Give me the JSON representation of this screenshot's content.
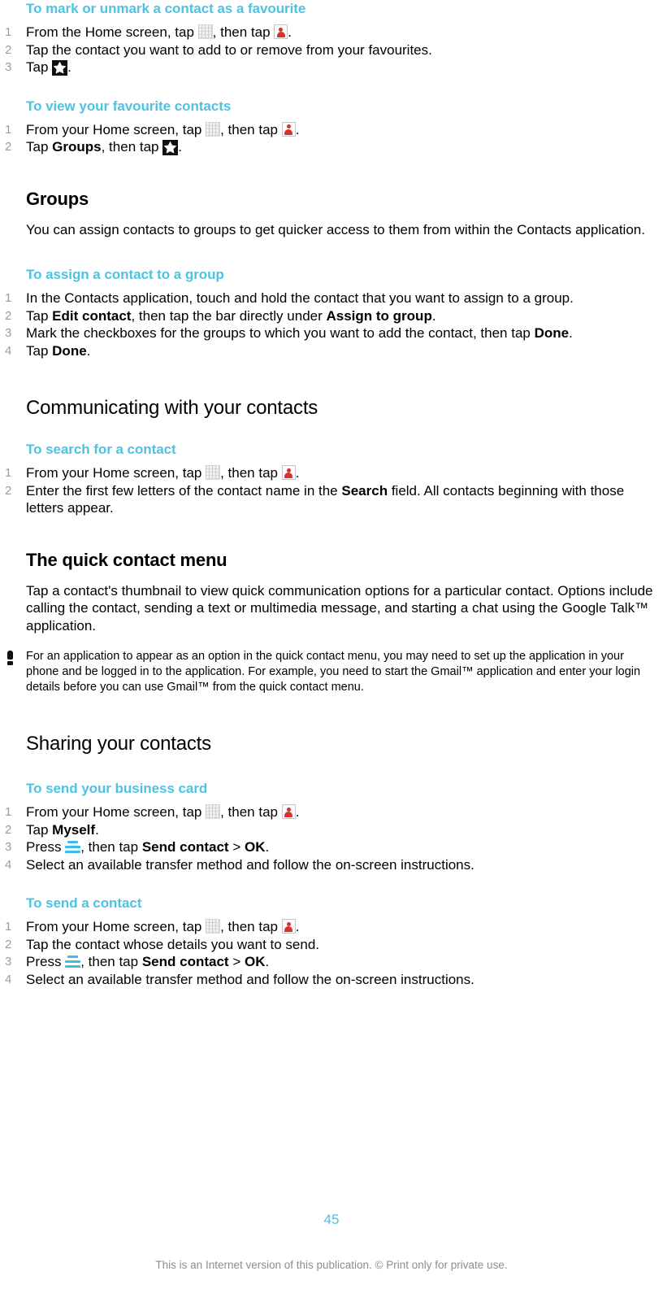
{
  "colors": {
    "heading_accent": "#4FC2E3",
    "step_number": "#9c9c9c",
    "body_text": "#000000",
    "footer_text": "#8d8d8d",
    "menu_key": "#3FBCE0",
    "contacts_icon_red": "#d8322c"
  },
  "sections": {
    "favourite": {
      "heading": "To mark or unmark a contact as a favourite",
      "step1_a": "From the Home screen, tap",
      "step1_b": ", then tap",
      "step1_c": ".",
      "step2": "Tap the contact you want to add to or remove from your favourites.",
      "step3_a": "Tap",
      "step3_b": "."
    },
    "view_favourites": {
      "heading": "To view your favourite contacts",
      "step1_a": "From your Home screen, tap",
      "step1_b": ", then tap",
      "step1_c": ".",
      "step2_a": "Tap",
      "step2_bold": "Groups",
      "step2_b": ", then tap",
      "step2_c": "."
    },
    "groups": {
      "heading": "Groups",
      "intro": "You can assign contacts to groups to get quicker access to them from within the Contacts application."
    },
    "assign_group": {
      "heading": "To assign a contact to a group",
      "step1": "In the Contacts application, touch and hold the contact that you want to assign to a group.",
      "step2_a": "Tap",
      "step2_bold1": "Edit contact",
      "step2_b": ", then tap the bar directly under",
      "step2_bold2": "Assign to group",
      "step2_c": ".",
      "step3_a": "Mark the checkboxes for the groups to which you want to add the contact, then tap",
      "step3_bold": "Done",
      "step3_b": ".",
      "step4_a": "Tap",
      "step4_bold": "Done",
      "step4_b": "."
    },
    "communicating": {
      "heading": "Communicating with your contacts"
    },
    "search_contact": {
      "heading": "To search for a contact",
      "step1_a": "From your Home screen, tap",
      "step1_b": ", then tap",
      "step1_c": ".",
      "step2_a": "Enter the first few letters of the contact name in the",
      "step2_bold": "Search",
      "step2_b": "field. All contacts beginning with those letters appear."
    },
    "quick_contact": {
      "heading": "The quick contact menu",
      "paragraph": "Tap a contact's thumbnail to view quick communication options for a particular contact. Options include calling the contact, sending a text or multimedia message, and starting a chat using the Google Talk™ application.",
      "note": "For an application to appear as an option in the quick contact menu, you may need to set up the application in your phone and be logged in to the application. For example, you need to start the Gmail™ application and enter your login details before you can use Gmail™ from the quick contact menu."
    },
    "sharing": {
      "heading": "Sharing your contacts"
    },
    "business_card": {
      "heading": "To send your business card",
      "step1_a": "From your Home screen, tap",
      "step1_b": ", then tap",
      "step1_c": ".",
      "step2_a": "Tap",
      "step2_bold": "Myself",
      "step2_b": ".",
      "step3_a": "Press",
      "step3_b": ", then tap",
      "step3_bold1": "Send contact",
      "step3_gt": ">",
      "step3_bold2": "OK",
      "step3_c": ".",
      "step4": "Select an available transfer method and follow the on-screen instructions."
    },
    "send_contact": {
      "heading": "To send a contact",
      "step1_a": "From your Home screen, tap",
      "step1_b": ", then tap",
      "step1_c": ".",
      "step2": "Tap the contact whose details you want to send.",
      "step3_a": "Press",
      "step3_b": ", then tap",
      "step3_bold1": "Send contact",
      "step3_gt": ">",
      "step3_bold2": "OK",
      "step3_c": ".",
      "step4": "Select an available transfer method and follow the on-screen instructions."
    }
  },
  "footer": {
    "page_number": "45",
    "note": "This is an Internet version of this publication. © Print only for private use."
  },
  "icons": {
    "app_grid": "app-grid-icon",
    "contacts": "contacts-icon",
    "star": "star-icon",
    "menu_key": "menu-key-icon",
    "note_bang": "exclamation-icon"
  }
}
